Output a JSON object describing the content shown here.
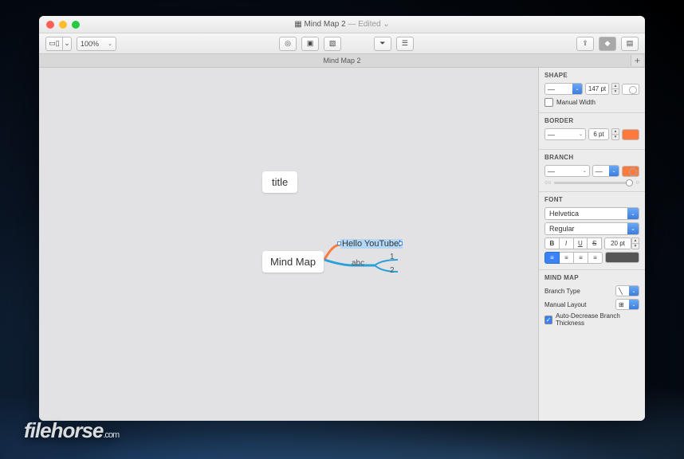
{
  "window": {
    "title": "Mind Map 2",
    "edited": "— Edited"
  },
  "toolbar": {
    "zoom": "100%"
  },
  "tab": {
    "name": "Mind Map 2",
    "add": "+"
  },
  "canvas": {
    "title_node": "title",
    "main_node": "Mind Map",
    "branch1": "Hello YouTube!",
    "branch2": "abc",
    "leaf1": "1",
    "leaf2": "2"
  },
  "inspector": {
    "shape": {
      "heading": "SHAPE",
      "width_value": "147 pt",
      "manual_width": "Manual Width"
    },
    "border": {
      "heading": "BORDER",
      "pt": "6 pt",
      "color": "#ff7a3c"
    },
    "branch": {
      "heading": "BRANCH",
      "color": "#ff7a3c"
    },
    "font": {
      "heading": "FONT",
      "family": "Helvetica",
      "style": "Regular",
      "b": "B",
      "i": "I",
      "u": "U",
      "s": "S",
      "size": "20 pt"
    },
    "mindmap": {
      "heading": "MIND MAP",
      "branch_type": "Branch Type",
      "manual_layout": "Manual Layout",
      "auto_decrease": "Auto-Decrease Branch Thickness"
    }
  },
  "watermark": "filehorse",
  "watermark_suffix": ".com"
}
